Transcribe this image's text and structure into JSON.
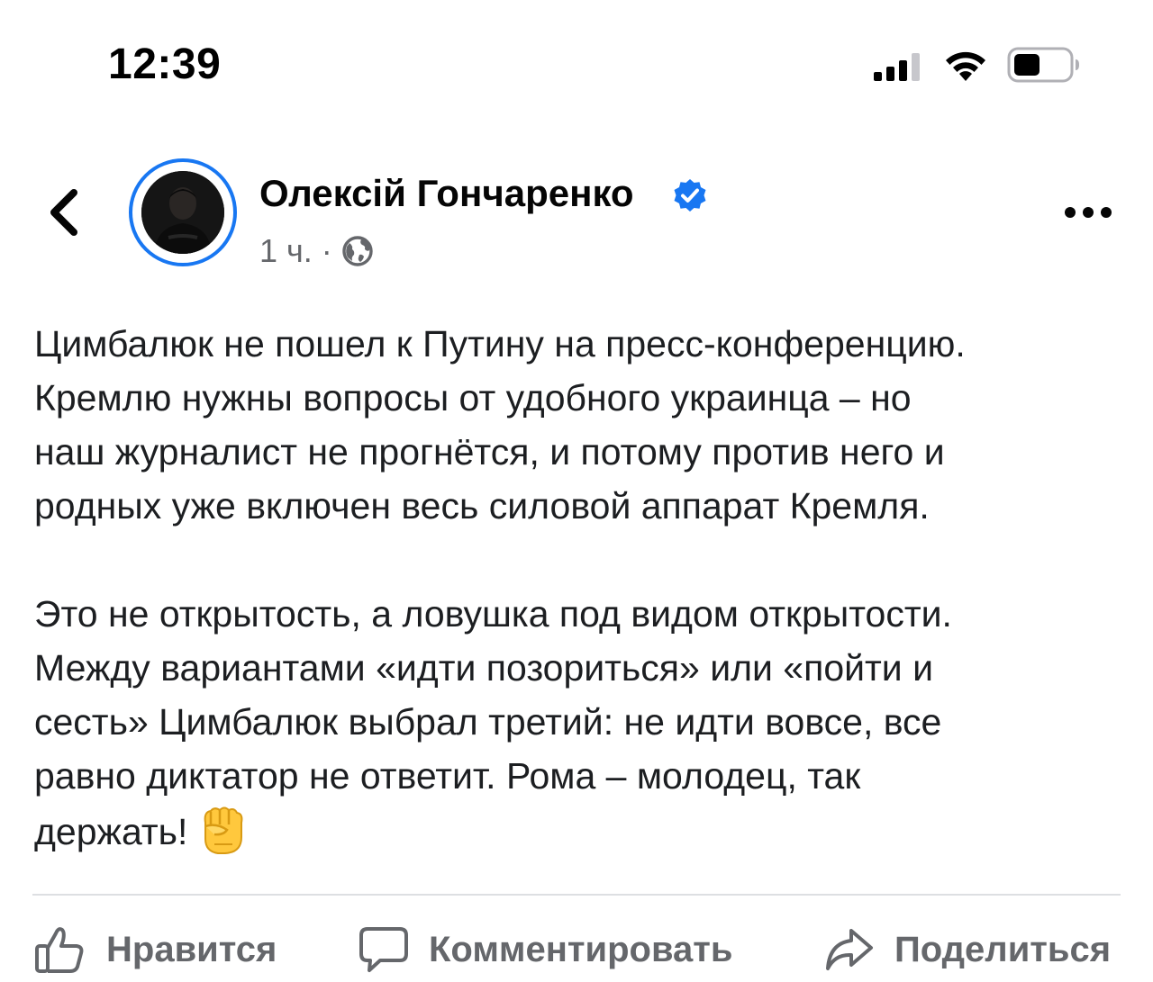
{
  "status_bar": {
    "time": "12:39",
    "icons": [
      "cellular-signal-icon",
      "wifi-icon",
      "battery-icon"
    ]
  },
  "header": {
    "back_icon": "chevron-left-icon",
    "author_name": "Олексій Гончаренко",
    "verified_icon": "verified-badge-icon",
    "timestamp": "1 ч.",
    "separator": "·",
    "audience_icon": "globe-icon",
    "more_icon": "more-dots-icon"
  },
  "post": {
    "paragraph_1": "Цимбалюк не пошел к Путину на пресс-конференцию.\nКремлю нужны вопросы от удобного украинца – но\nнаш журналист не прогнётся, и потому против него и\nродных уже включен весь силовой аппарат Кремля.",
    "paragraph_2": "Это не открытость, а ловушка под видом открытости.\nМежду вариантами «идти позориться» или «пойти и\nсесть» Цимбалюк выбрал третий: не идти вовсе, все\nравно диктатор не ответит. Рома – молодец, так\nдержать!",
    "emoji_icon": "raised-fist-emoji"
  },
  "actions": {
    "like_label": "Нравится",
    "comment_label": "Комментировать",
    "share_label": "Поделиться"
  },
  "colors": {
    "accent": "#1877f2",
    "secondary_text": "#65676b",
    "primary_text": "#050505",
    "divider": "#dddfe2"
  }
}
